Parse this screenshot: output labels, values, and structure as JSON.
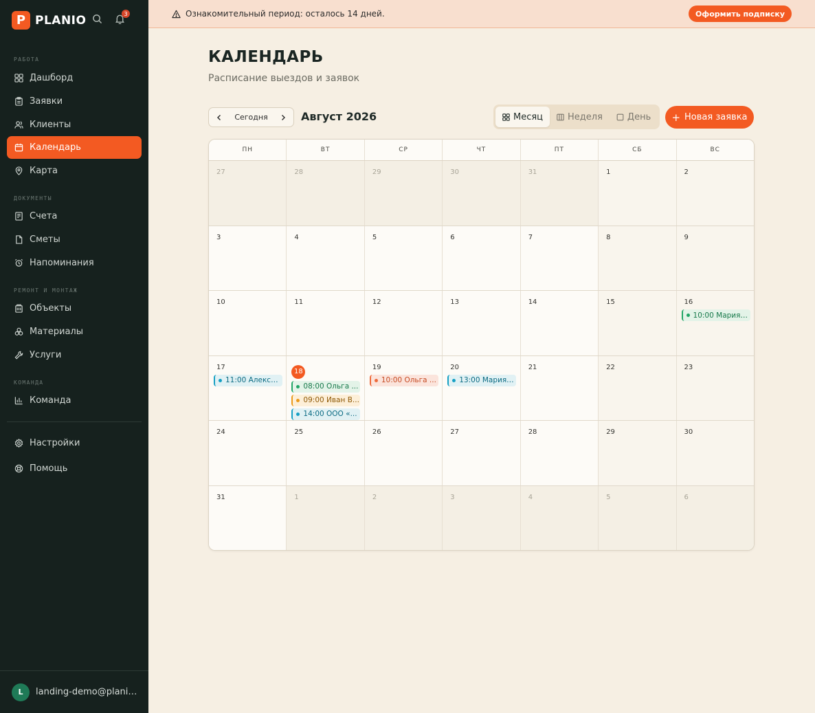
{
  "brand": {
    "logo_letter": "P",
    "name": "PLANIO",
    "notifications_count": "3"
  },
  "sidebar": {
    "sections": [
      {
        "label": "РАБОТА",
        "items": [
          {
            "label": "Дашборд",
            "icon": "grid-icon"
          },
          {
            "label": "Заявки",
            "icon": "clipboard-icon"
          },
          {
            "label": "Клиенты",
            "icon": "users-icon"
          },
          {
            "label": "Календарь",
            "icon": "calendar-icon",
            "active": true
          },
          {
            "label": "Карта",
            "icon": "map-pin-icon"
          }
        ]
      },
      {
        "label": "ДОКУМЕНТЫ",
        "items": [
          {
            "label": "Счета",
            "icon": "invoice-icon"
          },
          {
            "label": "Сметы",
            "icon": "file-icon"
          },
          {
            "label": "Напоминания",
            "icon": "alarm-icon"
          }
        ]
      },
      {
        "label": "РЕМОНТ И МОНТАЖ",
        "items": [
          {
            "label": "Объекты",
            "icon": "building-icon"
          },
          {
            "label": "Материалы",
            "icon": "boxes-icon"
          },
          {
            "label": "Услуги",
            "icon": "wrench-icon"
          }
        ]
      },
      {
        "label": "КОМАНДА",
        "items": [
          {
            "label": "Команда",
            "icon": "bar-chart-icon"
          }
        ]
      }
    ],
    "bottom_items": [
      {
        "label": "Настройки",
        "icon": "gear-icon"
      },
      {
        "label": "Помощь",
        "icon": "help-icon"
      }
    ],
    "user": {
      "avatar_letter": "L",
      "email": "landing-demo@planio.ru"
    }
  },
  "banner": {
    "text": "Ознакомительный период: осталось 14 дней.",
    "button_label": "Оформить подписку"
  },
  "header": {
    "title": "КАЛЕНДАРЬ",
    "subtitle": "Расписание выездов и заявок"
  },
  "toolbar": {
    "today_label": "Сегодня",
    "month_label": "Август 2026",
    "views": [
      {
        "label": "Месяц",
        "icon": "grid-icon",
        "active": true
      },
      {
        "label": "Неделя",
        "icon": "columns-icon",
        "active": false
      },
      {
        "label": "День",
        "icon": "square-icon",
        "active": false
      }
    ],
    "new_button_label": "Новая заявка"
  },
  "calendar": {
    "weekdays": [
      "ПН",
      "ВТ",
      "СР",
      "ЧТ",
      "ПТ",
      "СБ",
      "ВС"
    ],
    "today": 18,
    "weeks": [
      [
        {
          "day": "27",
          "outside": true
        },
        {
          "day": "28",
          "outside": true
        },
        {
          "day": "29",
          "outside": true
        },
        {
          "day": "30",
          "outside": true
        },
        {
          "day": "31",
          "outside": true
        },
        {
          "day": "1"
        },
        {
          "day": "2"
        }
      ],
      [
        {
          "day": "3"
        },
        {
          "day": "4"
        },
        {
          "day": "5"
        },
        {
          "day": "6"
        },
        {
          "day": "7"
        },
        {
          "day": "8"
        },
        {
          "day": "9"
        }
      ],
      [
        {
          "day": "10"
        },
        {
          "day": "11"
        },
        {
          "day": "12"
        },
        {
          "day": "13"
        },
        {
          "day": "14"
        },
        {
          "day": "15"
        },
        {
          "day": "16",
          "events": [
            {
              "text": "10:00 Мария ...",
              "color": "green"
            }
          ]
        }
      ],
      [
        {
          "day": "17",
          "events": [
            {
              "text": "11:00 Алексе...",
              "color": "teal"
            }
          ]
        },
        {
          "day": "18",
          "today": true,
          "events": [
            {
              "text": "08:00 Ольга ...",
              "color": "green"
            },
            {
              "text": "09:00 Иван В...",
              "color": "amber"
            },
            {
              "text": "14:00 ООО «...",
              "color": "teal"
            }
          ]
        },
        {
          "day": "19",
          "events": [
            {
              "text": "10:00 Ольга ...",
              "color": "red"
            }
          ]
        },
        {
          "day": "20",
          "events": [
            {
              "text": "13:00 Мария ...",
              "color": "teal"
            }
          ]
        },
        {
          "day": "21"
        },
        {
          "day": "22"
        },
        {
          "day": "23"
        }
      ],
      [
        {
          "day": "24"
        },
        {
          "day": "25"
        },
        {
          "day": "26"
        },
        {
          "day": "27"
        },
        {
          "day": "28"
        },
        {
          "day": "29"
        },
        {
          "day": "30"
        }
      ],
      [
        {
          "day": "31"
        },
        {
          "day": "1",
          "outside": true
        },
        {
          "day": "2",
          "outside": true
        },
        {
          "day": "3",
          "outside": true
        },
        {
          "day": "4",
          "outside": true
        },
        {
          "day": "5",
          "outside": true
        },
        {
          "day": "6",
          "outside": true
        }
      ]
    ]
  },
  "colors": {
    "accent": "#f35a22",
    "sidebar_bg": "#16211e",
    "page_bg": "#f6efe3"
  }
}
